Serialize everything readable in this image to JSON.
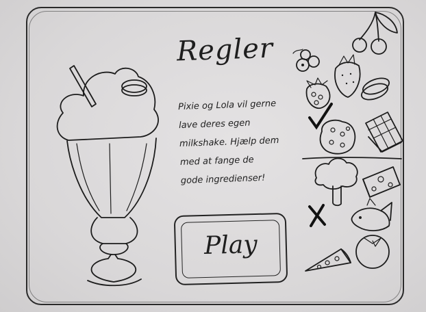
{
  "screen": {
    "title": "Regler",
    "rules_lines": [
      "Pixie og Lola vil gerne",
      "lave deres egen",
      "milkshake. Hjælp dem",
      "med at fange de",
      "gode ingredienser!"
    ],
    "play_label": "Play"
  },
  "ingredients": {
    "good": [
      "blueberries-icon",
      "cherries-icon",
      "strawberry-icon",
      "raspberry-icon",
      "cookie-icon",
      "chocolate-chip-cookie-icon",
      "chocolate-bar-icon"
    ],
    "bad": [
      "broccoli-icon",
      "cheese-icon",
      "pizza-slice-icon",
      "fish-icon"
    ]
  },
  "colors": {
    "ink": "#1c1c1c",
    "paper": "#dcdadb"
  }
}
